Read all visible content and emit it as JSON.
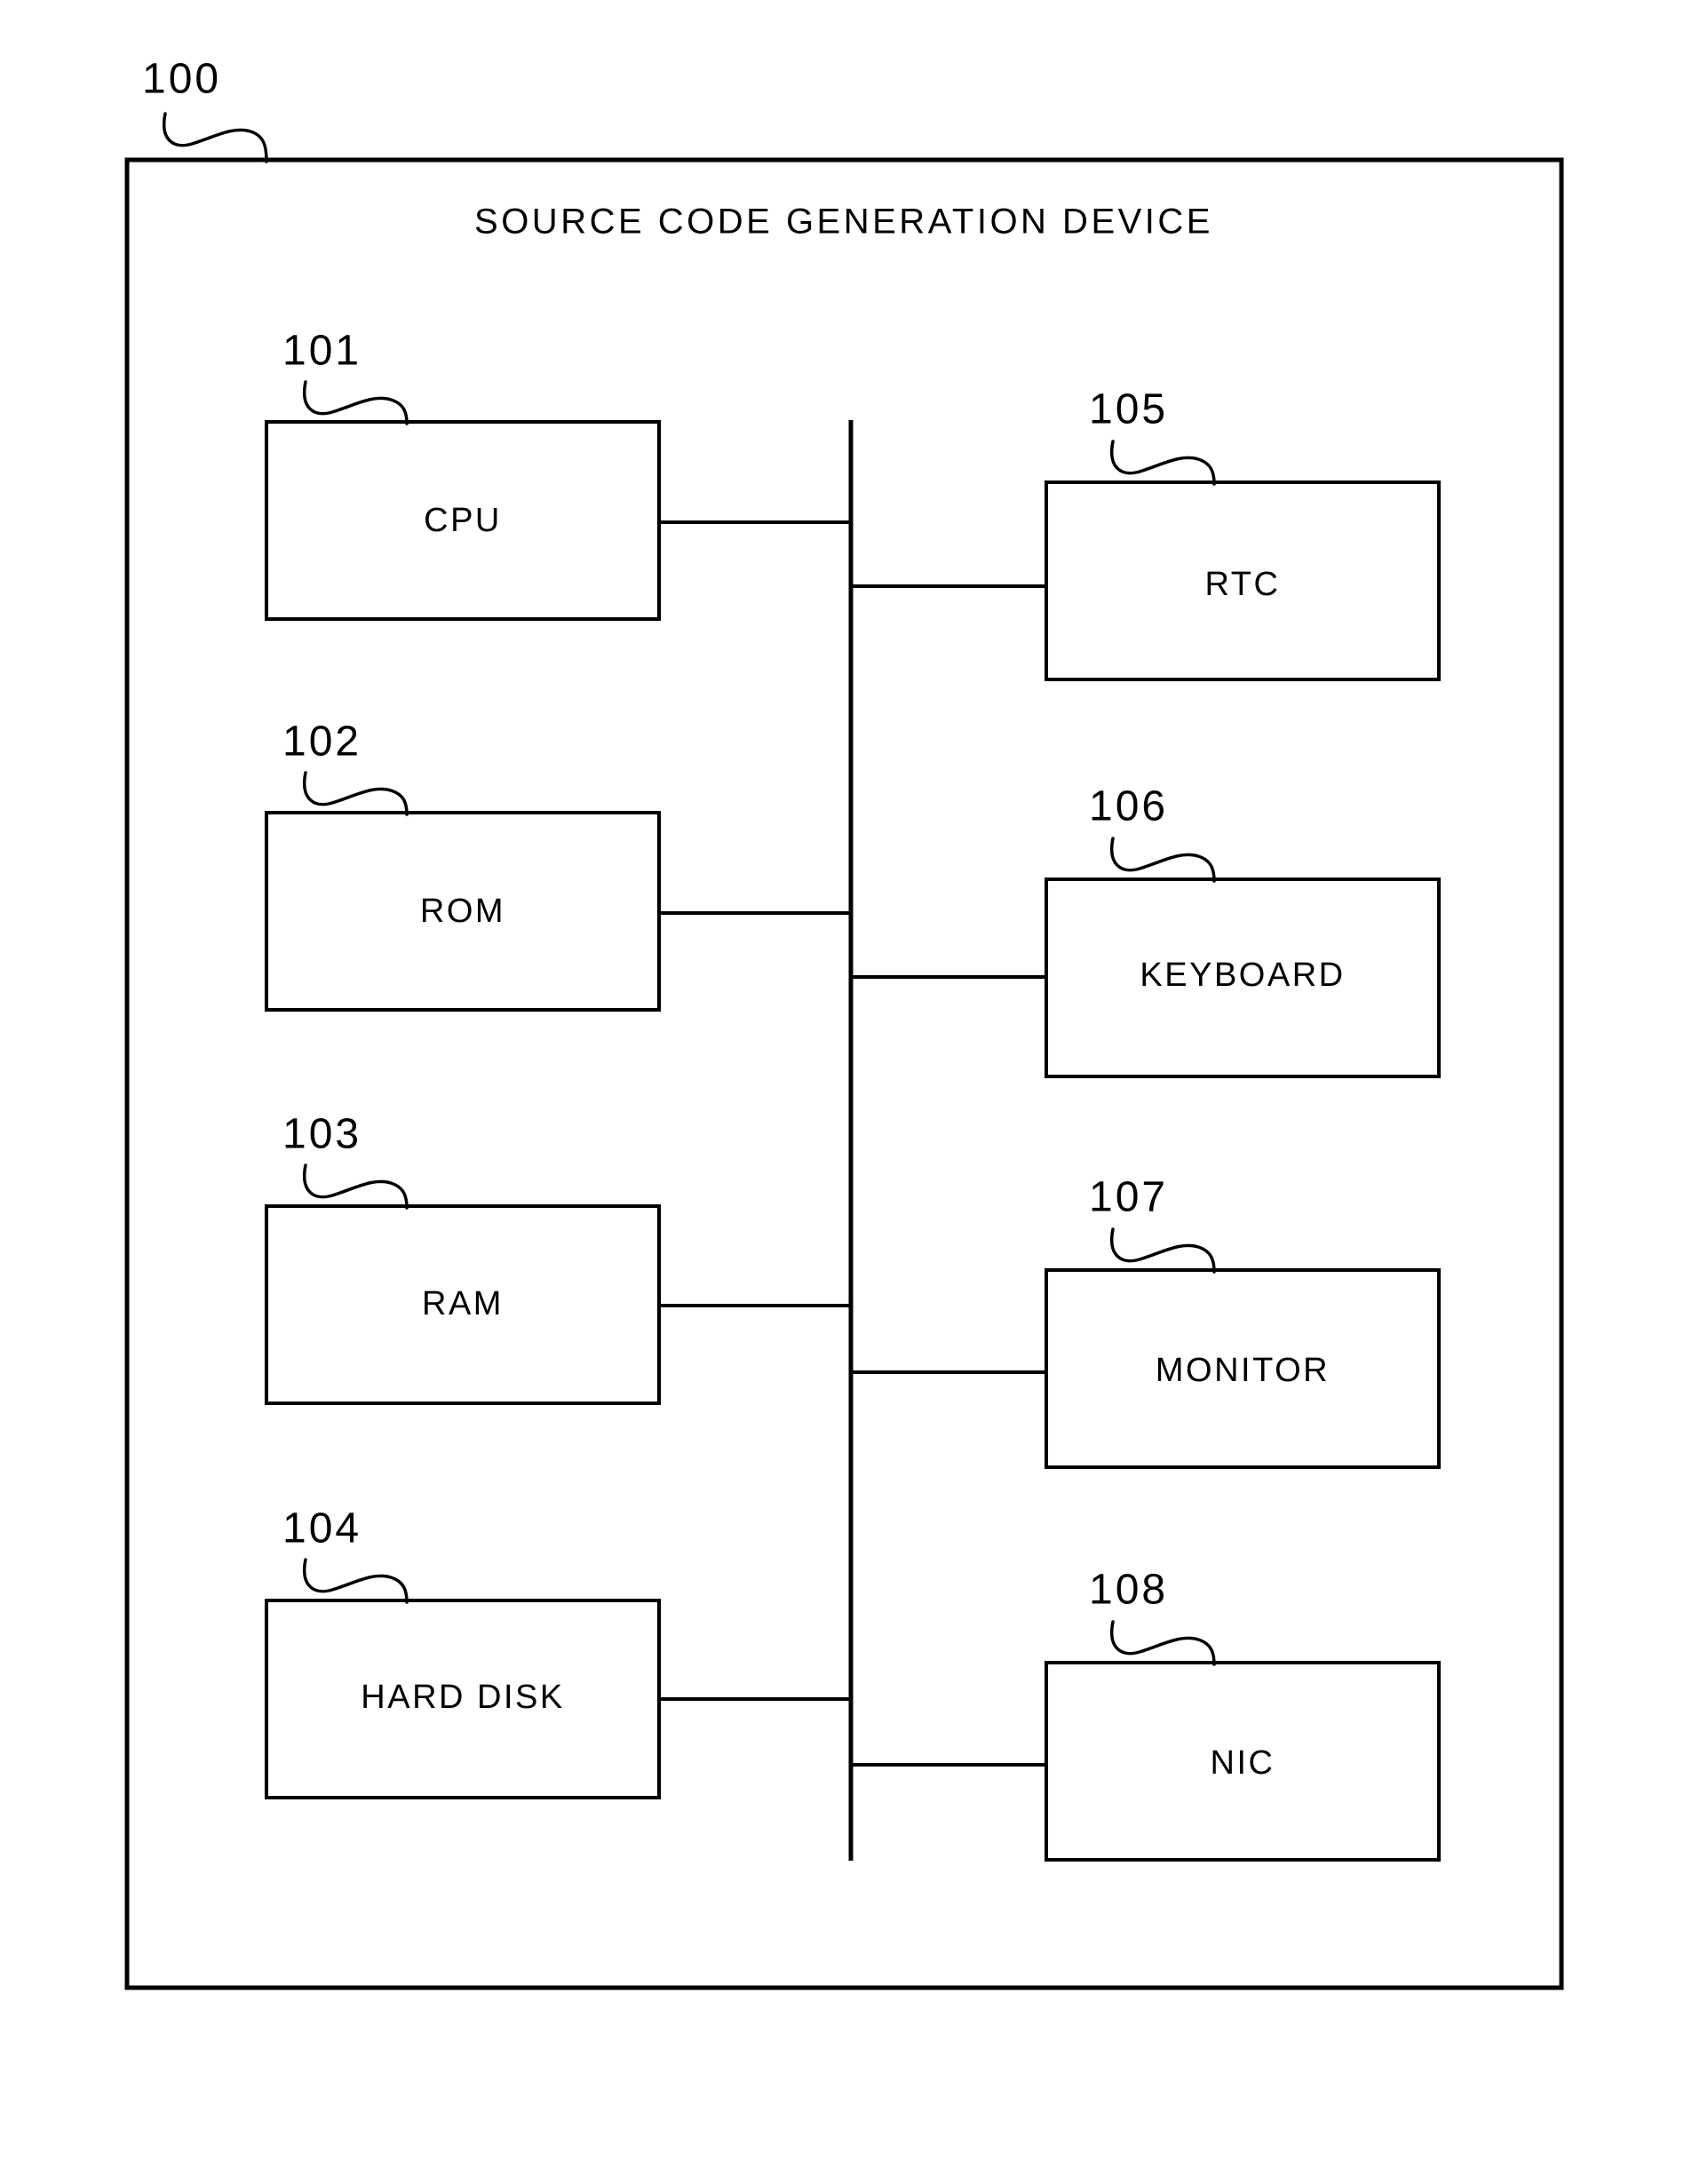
{
  "figure": {
    "type": "block-diagram",
    "background_color": "#ffffff",
    "stroke_color": "#000000",
    "frame": {
      "reference_numeral": "100",
      "title": "SOURCE CODE GENERATION DEVICE"
    },
    "bus": {
      "name": "internal-bus"
    },
    "left_column_blocks": [
      {
        "reference_numeral": "101",
        "label": "CPU"
      },
      {
        "reference_numeral": "102",
        "label": "ROM"
      },
      {
        "reference_numeral": "103",
        "label": "RAM"
      },
      {
        "reference_numeral": "104",
        "label": "HARD DISK"
      }
    ],
    "right_column_blocks": [
      {
        "reference_numeral": "105",
        "label": "RTC"
      },
      {
        "reference_numeral": "106",
        "label": "KEYBOARD"
      },
      {
        "reference_numeral": "107",
        "label": "MONITOR"
      },
      {
        "reference_numeral": "108",
        "label": "NIC"
      }
    ]
  }
}
